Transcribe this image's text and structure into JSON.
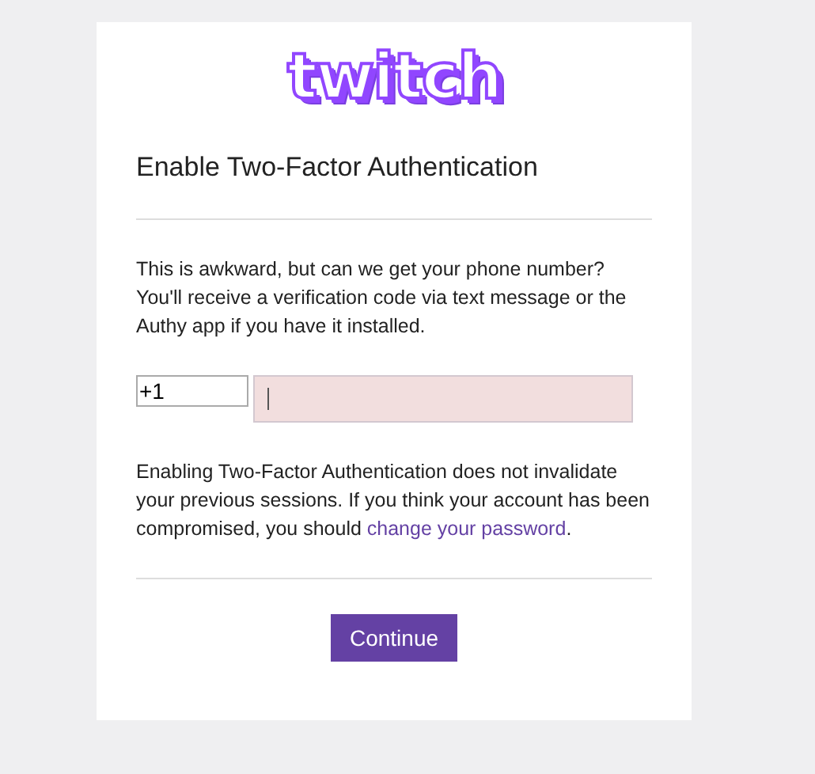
{
  "logo": "twitch",
  "title": "Enable Two-Factor Authentication",
  "intro": "This is awkward, but can we get your phone number? You'll receive a verification code via text message or the Authy app if you have it installed.",
  "country_code": {
    "value": "+1"
  },
  "phone": {
    "invalid": true,
    "focused": true
  },
  "note": {
    "text": "Enabling Two-Factor Authentication does not invalidate your previous sessions. If you think your account has been compromised, you should ",
    "link": "change your password",
    "after": "."
  },
  "buttons": [
    {
      "label": "Continue",
      "kind": "primary"
    }
  ]
}
